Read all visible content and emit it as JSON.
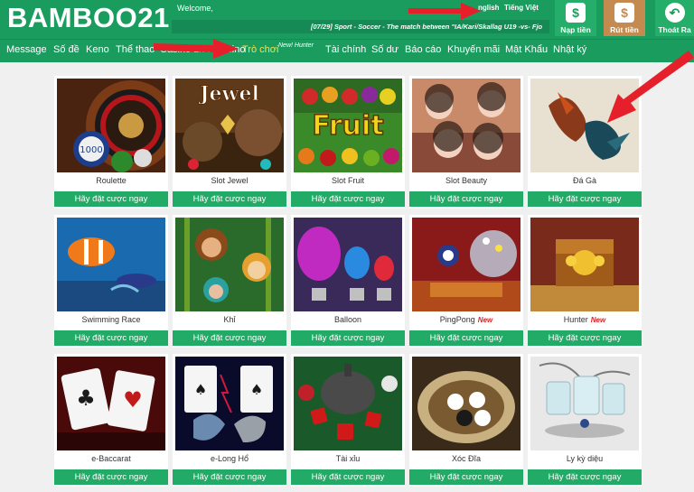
{
  "header": {
    "logo": "BAMBOO21",
    "welcome": "Welcome,",
    "lang_en": "nglish",
    "lang_vi": "Tiếng Việt",
    "ticker": "[07/29] Sport - Soccer - The match between \"IA/Kari/Skallag U19 -vs- Fjo",
    "deposit_label": "Nạp tiền",
    "withdraw_label": "Rút tiền",
    "logout_label": "Thoát Ra"
  },
  "nav": {
    "items": [
      "Message",
      "Số đề",
      "Keno",
      "Thể thao",
      "Casino",
      "Live Casino",
      "Trò chơi",
      "Tài chính",
      "Số dư",
      "Báo cáo",
      "Khuyến mãi",
      "Mật Khẩu",
      "Nhật ký"
    ],
    "active": "Trò chơi",
    "new_tag": "New! Hunter"
  },
  "games": [
    {
      "name": "Roulette",
      "new": ""
    },
    {
      "name": "Slot Jewel",
      "new": ""
    },
    {
      "name": "Slot Fruit",
      "new": ""
    },
    {
      "name": "Slot Beauty",
      "new": ""
    },
    {
      "name": "Đá Gà",
      "new": ""
    },
    {
      "name": "Swimming Race",
      "new": ""
    },
    {
      "name": "Khỉ",
      "new": ""
    },
    {
      "name": "Balloon",
      "new": ""
    },
    {
      "name": "PingPong",
      "new": "New"
    },
    {
      "name": "Hunter",
      "new": "New"
    },
    {
      "name": "e-Baccarat",
      "new": ""
    },
    {
      "name": "e-Long Hổ",
      "new": ""
    },
    {
      "name": "Tài xỉu",
      "new": ""
    },
    {
      "name": "Xóc Đĩa",
      "new": ""
    },
    {
      "name": "Ly kỳ diệu",
      "new": ""
    }
  ],
  "thumb_text": {
    "jewel": "Jewel",
    "fruit": "Fruit",
    "chip": "1000"
  },
  "play_label": "Hãy đặt cược ngay",
  "colors": {
    "brand": "#1a9c5f",
    "button": "#21ab66",
    "active_nav": "#f7e04a",
    "new_badge": "#e02020",
    "arrow": "#e5202a"
  }
}
